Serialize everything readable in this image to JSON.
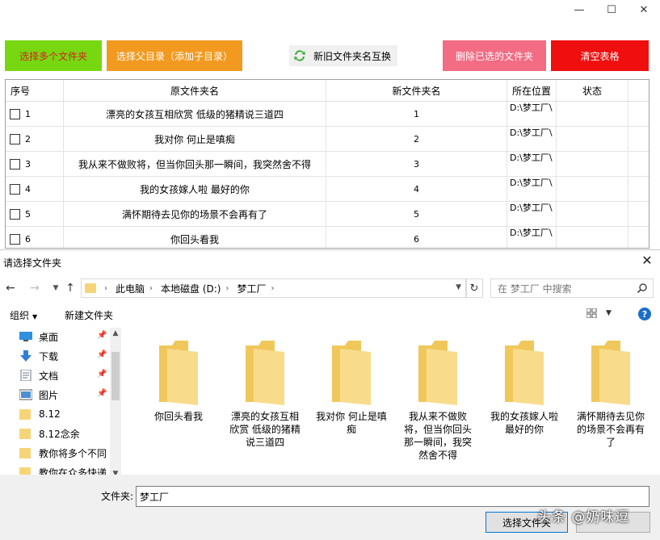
{
  "window": {
    "minimize": "—",
    "maximize": "☐",
    "close": "✕"
  },
  "toolbar": {
    "select_multiple": "选择多个文件夹",
    "select_parent": "选择父目录（添加子目录）",
    "swap_names": "新旧文件夹名互换",
    "delete_selected": "删除已选的文件夹",
    "clear_table": "清空表格"
  },
  "table": {
    "headers": [
      "序号",
      "原文件夹名",
      "新文件夹名",
      "所在位置",
      "状态"
    ],
    "rows": [
      {
        "index": "1",
        "original": "漂亮的女孩互相欣赏 低级的猪精说三道四",
        "new": "1",
        "location": "D:\\梦工厂\\",
        "status": ""
      },
      {
        "index": "2",
        "original": "我对你 何止是嗔痴",
        "new": "2",
        "location": "D:\\梦工厂\\",
        "status": ""
      },
      {
        "index": "3",
        "original": "我从来不做败将，但当你回头那一瞬间，我突然舍不得",
        "new": "3",
        "location": "D:\\梦工厂\\",
        "status": ""
      },
      {
        "index": "4",
        "original": "我的女孩嫁人啦 最好的你",
        "new": "4",
        "location": "D:\\梦工厂\\",
        "status": ""
      },
      {
        "index": "5",
        "original": "满怀期待去见你的场景不会再有了",
        "new": "5",
        "location": "D:\\梦工厂\\",
        "status": ""
      },
      {
        "index": "6",
        "original": "你回头看我",
        "new": "6",
        "location": "D:\\梦工厂\\",
        "status": ""
      }
    ]
  },
  "dialog": {
    "title": "请选择文件夹",
    "breadcrumb": [
      "此电脑",
      "本地磁盘 (D:)",
      "梦工厂"
    ],
    "search_placeholder": "在 梦工厂 中搜索",
    "organize": "组织",
    "new_folder": "新建文件夹",
    "help": "?",
    "sidebar": [
      {
        "label": "桌面",
        "icon": "desktop-icon",
        "pinned": true
      },
      {
        "label": "下载",
        "icon": "download-icon",
        "pinned": true
      },
      {
        "label": "文档",
        "icon": "document-icon",
        "pinned": true
      },
      {
        "label": "图片",
        "icon": "picture-icon",
        "pinned": true
      },
      {
        "label": "8.12",
        "icon": "folder-icon",
        "pinned": false
      },
      {
        "label": "8.12念余",
        "icon": "folder-icon",
        "pinned": false
      },
      {
        "label": "教你将多个不同",
        "icon": "folder-icon",
        "pinned": false
      },
      {
        "label": "教你在众多快递",
        "icon": "folder-icon",
        "pinned": false
      }
    ],
    "files": [
      "你回头看我",
      "漂亮的女孩互相欣赏 低级的猪精说三道四",
      "我对你 何止是嗔痴",
      "我从来不做败将，但当你回头那一瞬间，我突然舍不得",
      "我的女孩嫁人啦 最好的你",
      "满怀期待去见你的场景不会再有了"
    ],
    "filename_label": "文件夹:",
    "filename_value": "梦工厂",
    "ok_button": "选择文件夹",
    "watermark": "头条 @奶味逗"
  },
  "colors": {
    "select_multiple": "#77d811",
    "select_parent": "#f29a1f",
    "delete_selected": "#f26c84",
    "clear_table": "#f00f0f",
    "folder": "#f6d579"
  }
}
